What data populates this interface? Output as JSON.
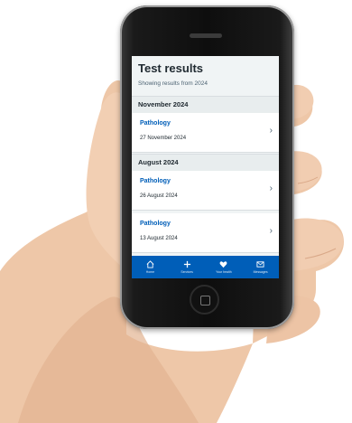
{
  "app": {
    "title": "Test results",
    "subtitle": "Showing results from 2024"
  },
  "groups": [
    {
      "month": "November 2024",
      "items": [
        {
          "title": "Pathology",
          "date": "27 November 2024"
        }
      ]
    },
    {
      "month": "August 2024",
      "items": [
        {
          "title": "Pathology",
          "date": "26 August 2024"
        },
        {
          "title": "Pathology",
          "date": "13 August 2024"
        }
      ]
    }
  ],
  "chevron": "›",
  "nav": [
    {
      "label": "Home",
      "icon": "home-icon"
    },
    {
      "label": "Services",
      "icon": "services-icon"
    },
    {
      "label": "Your health",
      "icon": "heart-icon"
    },
    {
      "label": "Messages",
      "icon": "messages-icon"
    }
  ],
  "colors": {
    "accent": "#005eb8",
    "background": "#f0f4f5",
    "text": "#212b32"
  }
}
